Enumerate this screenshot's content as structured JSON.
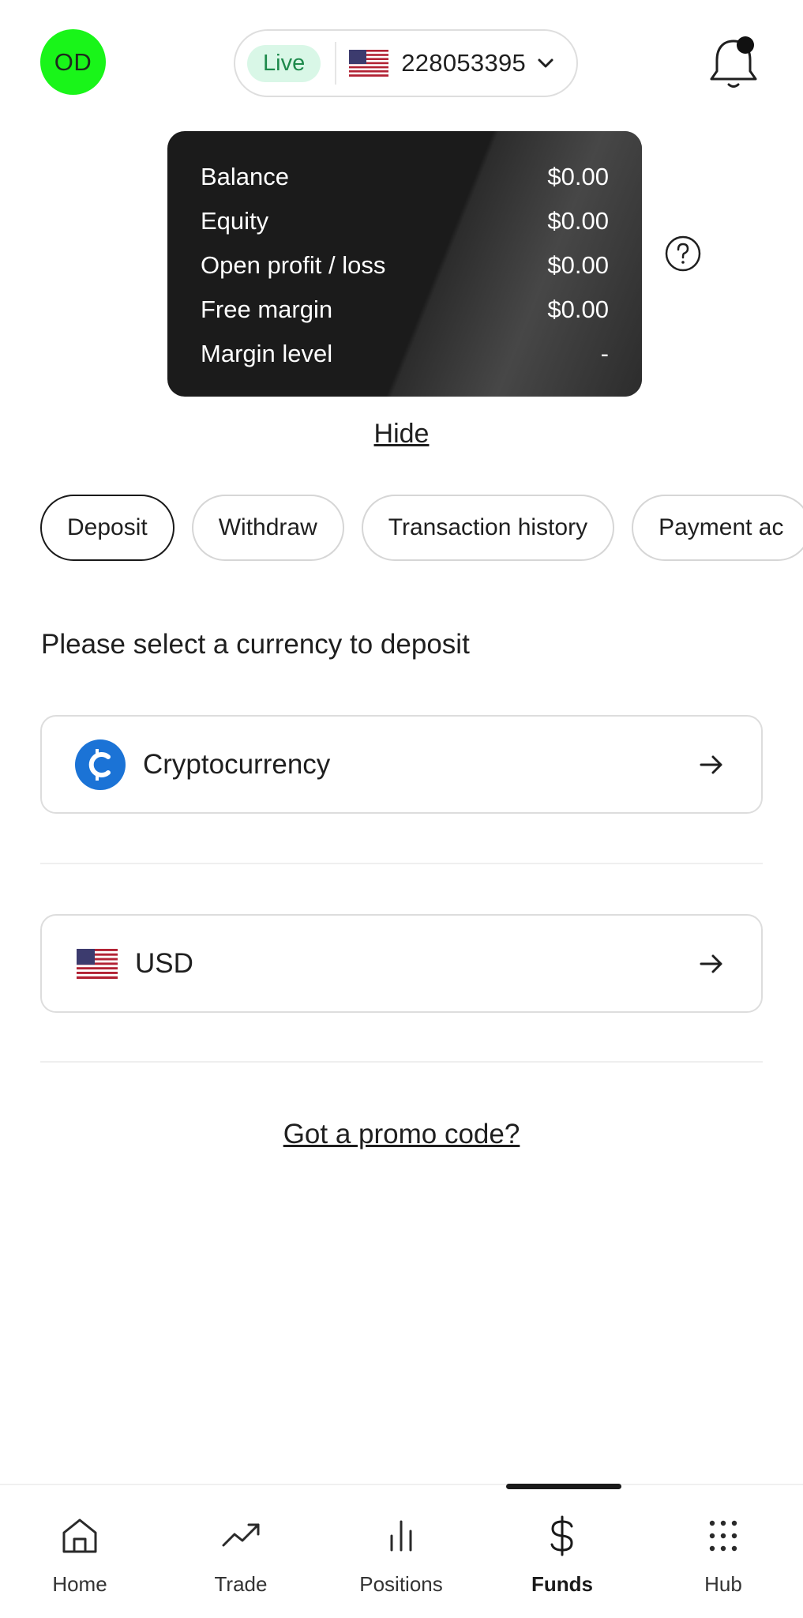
{
  "header": {
    "avatar_initials": "OD",
    "account_badge": "Live",
    "account_number": "228053395",
    "icons": {
      "flag": "us-flag-icon",
      "dropdown": "chevron-down-icon",
      "notifications": "bell-icon"
    }
  },
  "balance_card": {
    "rows": [
      {
        "label": "Balance",
        "value": "$0.00"
      },
      {
        "label": "Equity",
        "value": "$0.00"
      },
      {
        "label": "Open profit / loss",
        "value": "$0.00"
      },
      {
        "label": "Free margin",
        "value": "$0.00"
      },
      {
        "label": "Margin level",
        "value": "-"
      }
    ],
    "hide_label": "Hide"
  },
  "tabs": [
    {
      "label": "Deposit",
      "active": true
    },
    {
      "label": "Withdraw",
      "active": false
    },
    {
      "label": "Transaction history",
      "active": false
    },
    {
      "label": "Payment ac",
      "active": false
    }
  ],
  "deposit": {
    "title": "Please select a currency to deposit",
    "options": [
      {
        "label": "Cryptocurrency",
        "icon": "crypto-coin-icon"
      },
      {
        "label": "USD",
        "icon": "us-flag-icon"
      }
    ],
    "promo_label": "Got a promo code?"
  },
  "bottom_nav": [
    {
      "label": "Home",
      "icon": "home-icon",
      "active": false
    },
    {
      "label": "Trade",
      "icon": "trend-up-icon",
      "active": false
    },
    {
      "label": "Positions",
      "icon": "bars-icon",
      "active": false
    },
    {
      "label": "Funds",
      "icon": "dollar-icon",
      "active": true
    },
    {
      "label": "Hub",
      "icon": "grid-icon",
      "active": false
    }
  ],
  "colors": {
    "avatar": "#19f519",
    "live_badge_bg": "#d9f7e7",
    "live_badge_text": "#1e8a4c",
    "crypto_icon": "#1b73d6",
    "card_bg": "#1b1b1b"
  }
}
